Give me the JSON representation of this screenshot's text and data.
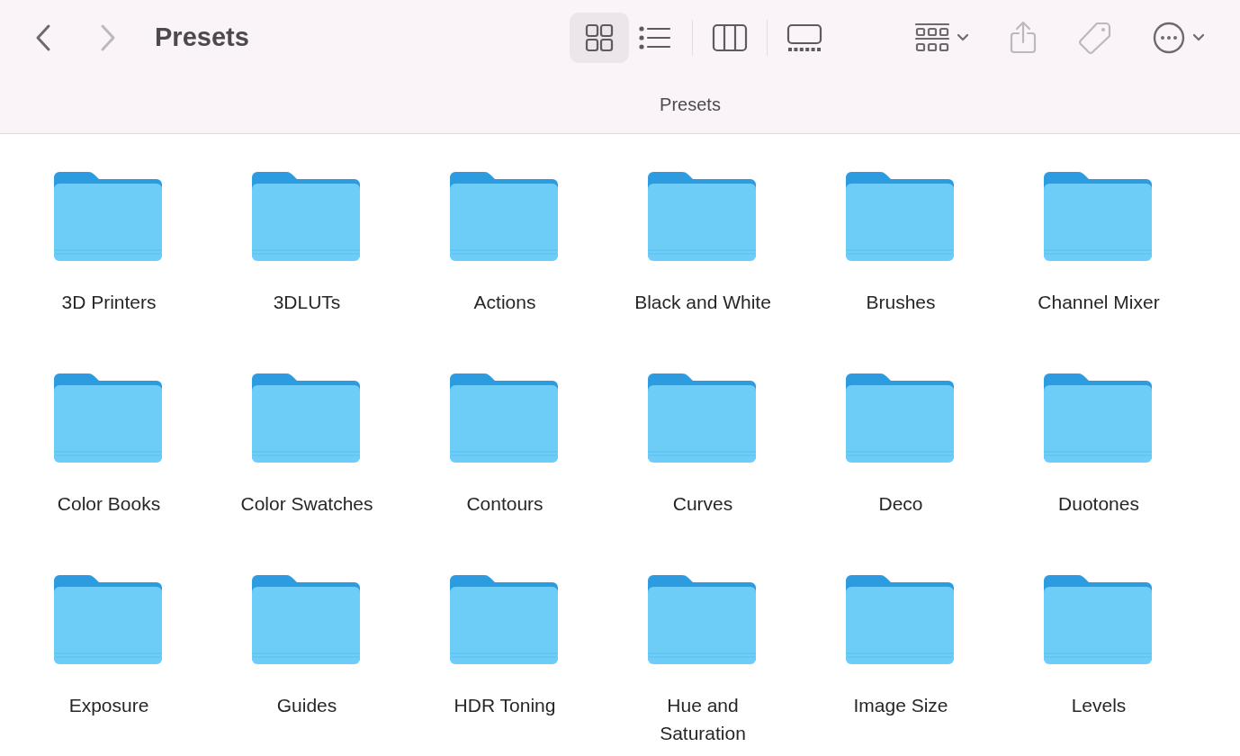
{
  "toolbar": {
    "back": {
      "disabled": false
    },
    "forward": {
      "disabled": true
    },
    "title": "Presets",
    "views": [
      {
        "kind": "icons",
        "selected": true
      },
      {
        "kind": "list",
        "selected": false
      },
      {
        "kind": "columns",
        "selected": false
      },
      {
        "kind": "gallery",
        "selected": false
      }
    ],
    "actions": [
      {
        "kind": "group",
        "disabled": false
      },
      {
        "kind": "share",
        "disabled": true
      },
      {
        "kind": "tag",
        "disabled": true
      },
      {
        "kind": "more",
        "disabled": false
      }
    ]
  },
  "path_label": "Presets",
  "folders": [
    {
      "lines": [
        "3D Printers"
      ]
    },
    {
      "lines": [
        "3DLUTs"
      ]
    },
    {
      "lines": [
        "Actions"
      ]
    },
    {
      "lines": [
        "Black and White"
      ]
    },
    {
      "lines": [
        "Brushes"
      ]
    },
    {
      "lines": [
        "Channel Mixer"
      ]
    },
    {
      "lines": [
        "Color Books"
      ]
    },
    {
      "lines": [
        "Color Swatches"
      ]
    },
    {
      "lines": [
        "Contours"
      ]
    },
    {
      "lines": [
        "Curves"
      ]
    },
    {
      "lines": [
        "Deco"
      ]
    },
    {
      "lines": [
        "Duotones"
      ]
    },
    {
      "lines": [
        "Exposure"
      ]
    },
    {
      "lines": [
        "Guides"
      ]
    },
    {
      "lines": [
        "HDR Toning"
      ]
    },
    {
      "lines": [
        "Hue and",
        "Saturation"
      ]
    },
    {
      "lines": [
        "Image Size"
      ]
    },
    {
      "lines": [
        "Levels"
      ]
    }
  ]
}
